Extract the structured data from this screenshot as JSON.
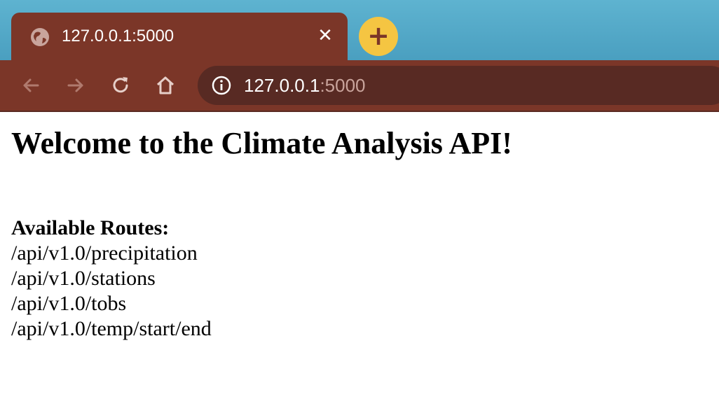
{
  "browser": {
    "tab_title": "127.0.0.1:5000",
    "url_host": "127.0.0.1",
    "url_port": ":5000",
    "accent_color": "#7b3628",
    "new_tab_color": "#f5c542",
    "icons": [
      "globe-icon",
      "close-icon",
      "plus-icon",
      "back-icon",
      "forward-icon",
      "reload-icon",
      "home-icon",
      "info-icon"
    ]
  },
  "page": {
    "title": "Welcome to the Climate Analysis API!",
    "routes_heading": "Available Routes:",
    "routes": [
      "/api/v1.0/precipitation",
      "/api/v1.0/stations",
      "/api/v1.0/tobs",
      "/api/v1.0/temp/start/end"
    ]
  }
}
